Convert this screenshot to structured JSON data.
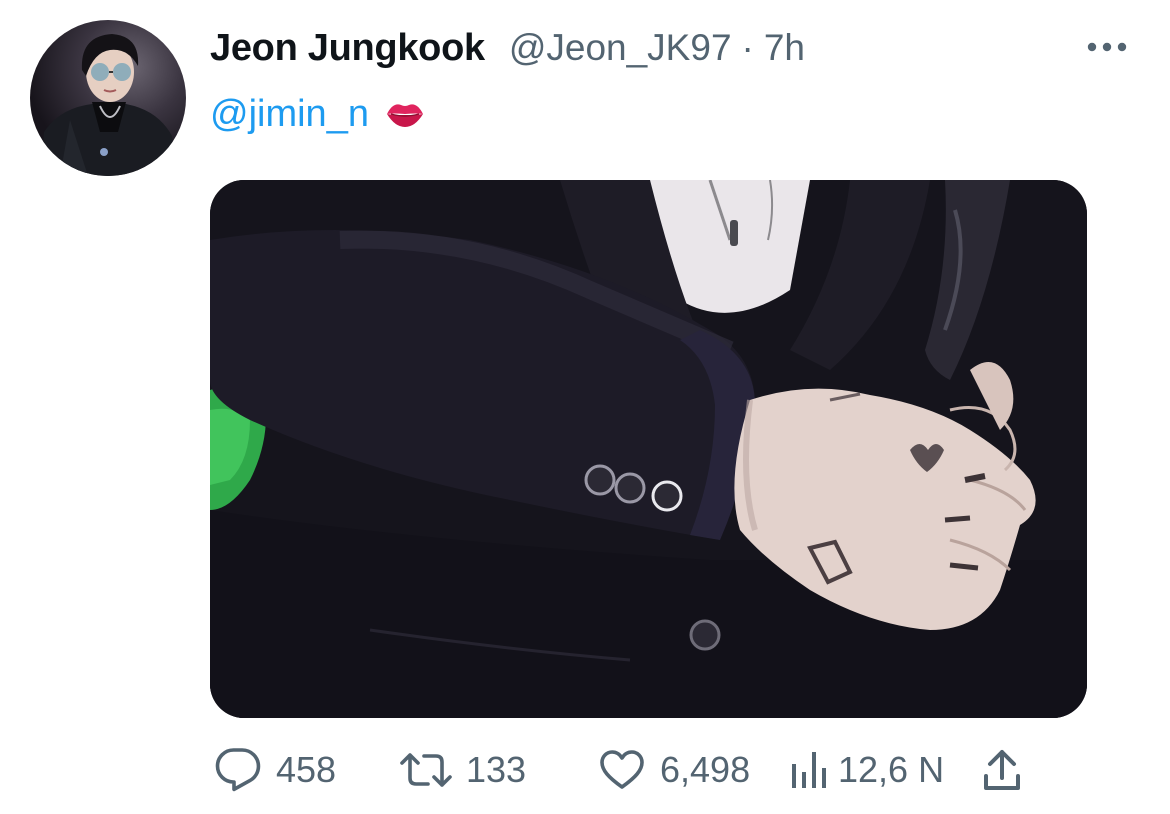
{
  "tweet": {
    "display_name": "Jeon Jungkook",
    "handle": "@Jeon_JK97",
    "separator": "·",
    "timestamp": "7h",
    "text_mention": "@jimin_n",
    "text_emoji": "kiss-mark-icon",
    "more_icon": "more-horizontal-icon",
    "media_description_icon": "photo"
  },
  "actions": {
    "reply": {
      "icon": "reply-icon",
      "count": "458"
    },
    "retweet": {
      "icon": "retweet-icon",
      "count": "133"
    },
    "like": {
      "icon": "heart-icon",
      "count": "6,498"
    },
    "views": {
      "icon": "views-chart-icon",
      "count": "12,6 N"
    },
    "share": {
      "icon": "share-icon"
    }
  },
  "colors": {
    "text_primary": "#0f1419",
    "text_secondary": "#536471",
    "link": "#1d9bf0",
    "kiss": "#e0245e"
  }
}
